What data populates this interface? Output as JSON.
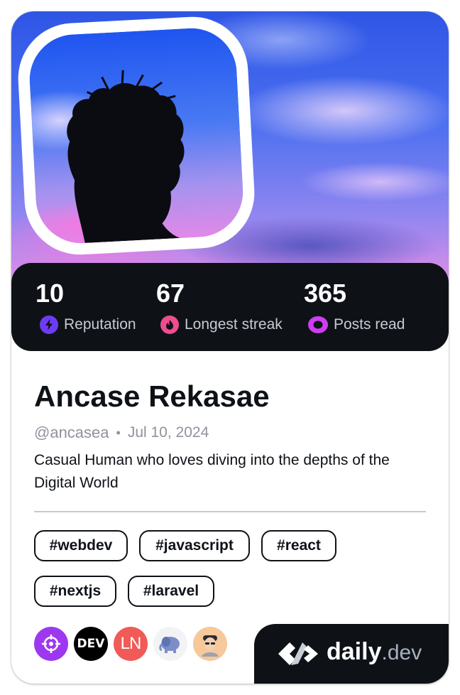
{
  "stats": [
    {
      "value": "10",
      "label": "Reputation",
      "icon": "reputation-bolt-icon",
      "color": "#6e3bf4"
    },
    {
      "value": "67",
      "label": "Longest streak",
      "icon": "streak-flame-icon",
      "color": "#ef4d8f"
    },
    {
      "value": "365",
      "label": "Posts read",
      "icon": "posts-read-eye-icon",
      "color": "#ce3df3"
    }
  ],
  "profile": {
    "name": "Ancase Rekasae",
    "handle": "@ancasea",
    "separator": "•",
    "joined": "Jul 10, 2024",
    "bio": "Casual Human who loves diving into the depths of the Digital World"
  },
  "tags": [
    "#webdev",
    "#javascript",
    "#react",
    "#nextjs",
    "#laravel"
  ],
  "sources": [
    {
      "name": "crosshair-source-icon",
      "label": "",
      "color": "#9d38f0"
    },
    {
      "name": "dev-to-source-icon",
      "label": "DEV",
      "color": "#000000"
    },
    {
      "name": "laravel-news-source-icon",
      "label": "LN",
      "color": "#f05a57"
    },
    {
      "name": "php-elephant-source-icon",
      "label": "",
      "color": "#f2f3f5"
    },
    {
      "name": "avatar-source-icon",
      "label": "",
      "color": "#f6c89a"
    }
  ],
  "brand": {
    "name": "daily",
    "suffix": ".dev"
  }
}
